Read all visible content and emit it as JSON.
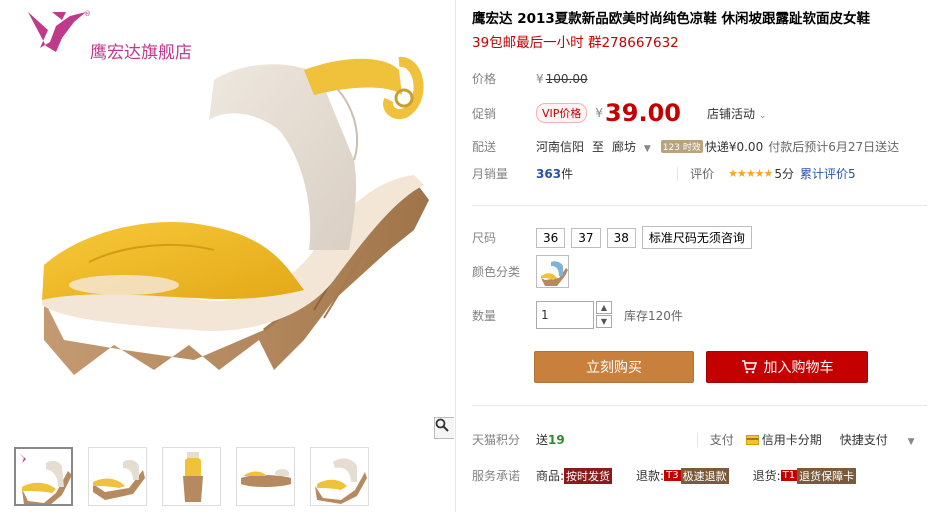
{
  "store": {
    "name": "鹰宏达旗舰店"
  },
  "gallery": {
    "zoom_icon": "magnifier-icon",
    "thumbnails": 5
  },
  "product": {
    "title": "鹰宏达 2013夏款新品欧美时尚纯色凉鞋 休闲坡跟露趾软面皮女鞋",
    "subtitle": "39包邮最后一小时 群278667632"
  },
  "price": {
    "label": "价格",
    "currency": "¥",
    "original": "100.00"
  },
  "promo": {
    "label": "促销",
    "vip_badge": "VIP价格",
    "currency": "¥",
    "value": "39.00",
    "store_activity": "店铺活动"
  },
  "delivery": {
    "label": "配送",
    "from": "河南信阳",
    "to_word": "至",
    "to": "廊坊",
    "tag": "123 时效",
    "express": "快递¥0.00",
    "note": "付款后预计6月27日送达"
  },
  "sales": {
    "label": "月销量",
    "count": "363",
    "unit": "件",
    "rating_label": "评价",
    "stars": "★★★★★",
    "score": "5分",
    "review_text": "累计评价5"
  },
  "size": {
    "label": "尺码",
    "options": [
      "36",
      "37",
      "38",
      "标准尺码无须咨询"
    ]
  },
  "color": {
    "label": "颜色分类"
  },
  "quantity": {
    "label": "数量",
    "value": "1",
    "stock": "库存120件"
  },
  "buttons": {
    "buy": "立刻购买",
    "cart": "加入购物车"
  },
  "points": {
    "label": "天猫积分",
    "send": "送",
    "value": "19",
    "pay_label": "支付",
    "credit": "信用卡分期",
    "quick": "快捷支付"
  },
  "service": {
    "label": "服务承诺",
    "goods_prefix": "商品:",
    "goods_tag": "按时发货",
    "refund_prefix": "退款:",
    "refund_t": "T3",
    "refund_tag": "极速退款",
    "return_prefix": "退货:",
    "return_t": "T1",
    "return_tag": "退货保障卡"
  },
  "colors": {
    "price_red": "#c40000",
    "buy_orange": "#c9803d",
    "store_magenta": "#c03a8c",
    "link_blue": "#2953a6"
  }
}
